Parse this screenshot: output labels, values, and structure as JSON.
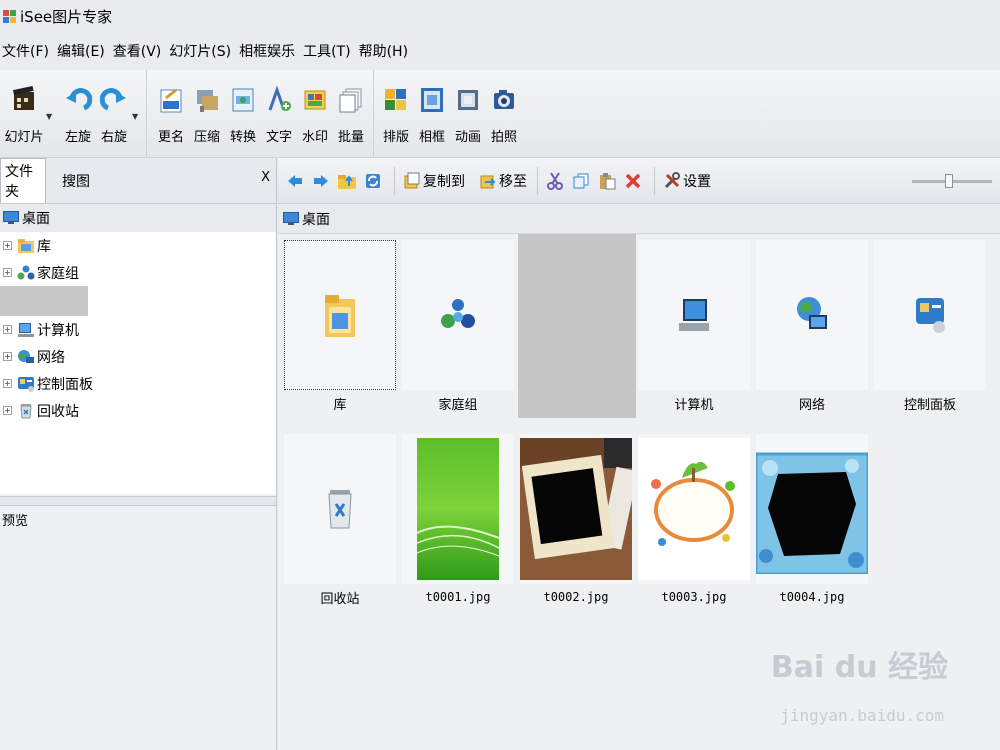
{
  "window": {
    "title": "iSee图片专家"
  },
  "menu": [
    "文件(F)",
    "编辑(E)",
    "查看(V)",
    "幻灯片(S)",
    "相框娱乐",
    "工具(T)",
    "帮助(H)"
  ],
  "toolbar": {
    "group1": [
      {
        "label": "幻灯片",
        "icon": "film-icon"
      },
      {
        "label": "左旋",
        "icon": "rotate-left-icon"
      },
      {
        "label": "右旋",
        "icon": "rotate-right-icon"
      }
    ],
    "group2": [
      {
        "label": "更名",
        "icon": "rename-icon"
      },
      {
        "label": "压缩",
        "icon": "compress-icon"
      },
      {
        "label": "转换",
        "icon": "convert-icon"
      },
      {
        "label": "文字",
        "icon": "text-icon"
      },
      {
        "label": "水印",
        "icon": "watermark-icon"
      },
      {
        "label": "批量",
        "icon": "batch-icon"
      }
    ],
    "group3": [
      {
        "label": "排版",
        "icon": "layout-icon"
      },
      {
        "label": "相框",
        "icon": "frame-icon"
      },
      {
        "label": "动画",
        "icon": "animation-icon"
      },
      {
        "label": "拍照",
        "icon": "camera-icon"
      }
    ]
  },
  "left_panel": {
    "tabs": [
      "文件夹",
      "搜图"
    ],
    "close_label": "X",
    "tree_root": "桌面",
    "tree_items": [
      "库",
      "家庭组",
      "计算机",
      "网络",
      "控制面板",
      "回收站"
    ],
    "expander_symbol": "+",
    "preview_label": "预览"
  },
  "nav_toolbar": {
    "copy_to": "复制到",
    "move_to": "移至",
    "settings": "设置",
    "zoom_level": 0.46
  },
  "location": "桌面",
  "items": [
    {
      "label": "库",
      "icon": "library-folder-icon",
      "selected": true
    },
    {
      "label": "家庭组",
      "icon": "homegroup-icon"
    },
    {
      "label": "",
      "icon": "",
      "placeholder": true
    },
    {
      "label": "计算机",
      "icon": "computer-icon"
    },
    {
      "label": "网络",
      "icon": "network-icon"
    },
    {
      "label": "控制面板",
      "icon": "control-panel-icon"
    },
    {
      "label": "回收站",
      "icon": "recycle-bin-icon"
    },
    {
      "label": "t0001.jpg",
      "icon": "green-image-thumbnail"
    },
    {
      "label": "t0002.jpg",
      "icon": "tablet-photo-thumbnail"
    },
    {
      "label": "t0003.jpg",
      "icon": "cartoon-frame-thumbnail"
    },
    {
      "label": "t0004.jpg",
      "icon": "blue-frame-thumbnail"
    }
  ],
  "watermark": {
    "brand": "Bai du 经验",
    "url": "jingyan.baidu.com"
  }
}
